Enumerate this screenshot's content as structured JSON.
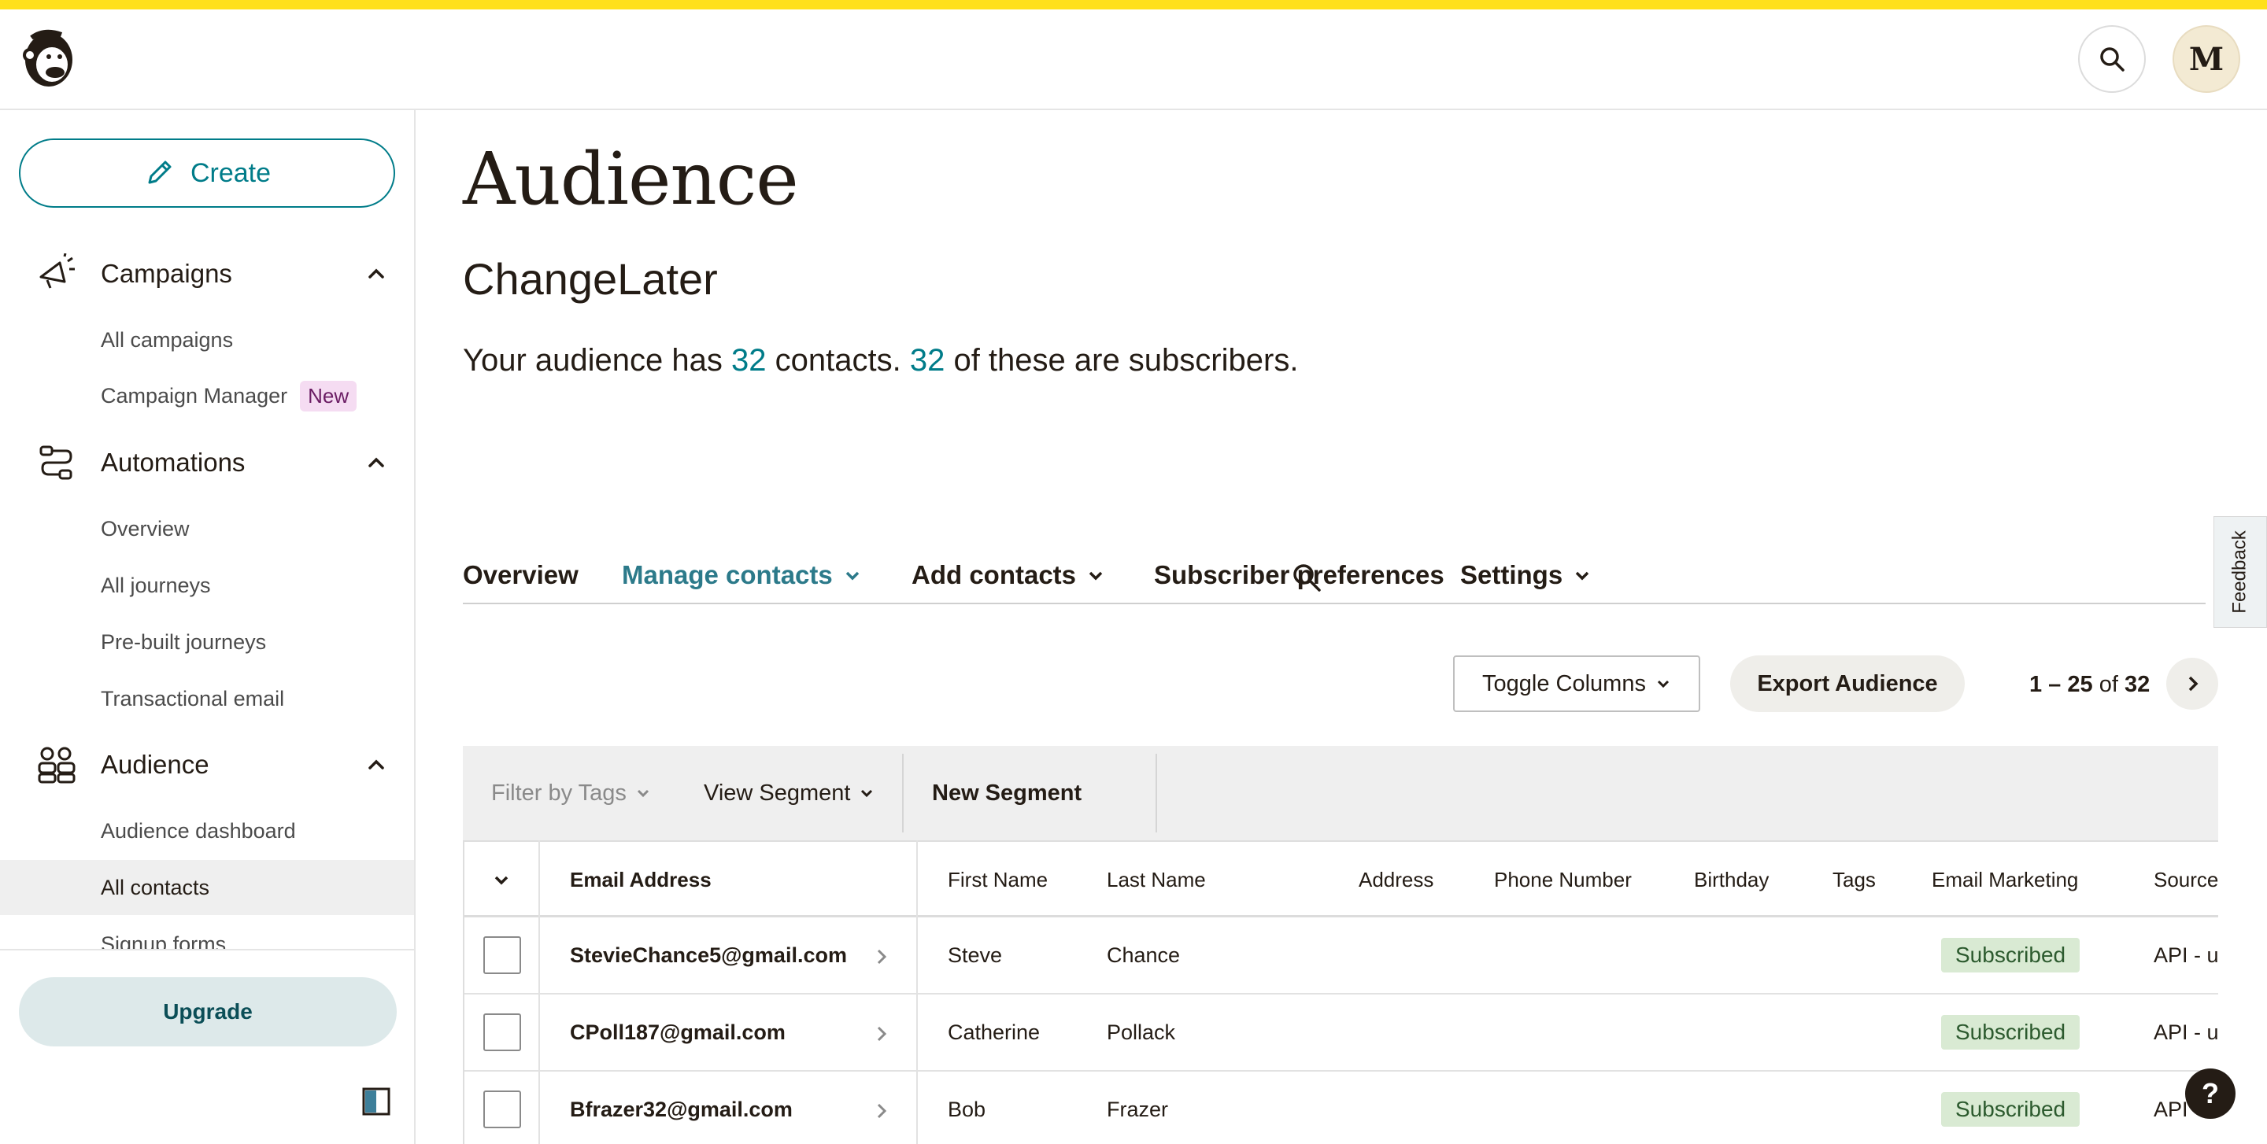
{
  "header": {
    "logo_icon": "mailchimp-freddie-icon",
    "search_icon": "search-icon",
    "avatar_letter": "M"
  },
  "sidebar": {
    "create_label": "Create",
    "sections": [
      {
        "label": "Campaigns",
        "icon": "megaphone-icon",
        "items": [
          {
            "label": "All campaigns"
          },
          {
            "label": "Campaign Manager",
            "badge": "New"
          }
        ]
      },
      {
        "label": "Automations",
        "icon": "workflow-icon",
        "items": [
          {
            "label": "Overview"
          },
          {
            "label": "All journeys"
          },
          {
            "label": "Pre-built journeys"
          },
          {
            "label": "Transactional email"
          }
        ]
      },
      {
        "label": "Audience",
        "icon": "people-icon",
        "items": [
          {
            "label": "Audience dashboard"
          },
          {
            "label": "All contacts",
            "active": true
          },
          {
            "label": "Signup forms"
          }
        ]
      }
    ],
    "upgrade_label": "Upgrade"
  },
  "main": {
    "title": "Audience",
    "audience_name": "ChangeLater",
    "summary": {
      "prefix": "Your audience has ",
      "contacts": "32",
      "middle": " contacts. ",
      "subscribers": "32",
      "suffix": " of these are subscribers."
    },
    "tabs": [
      {
        "label": "Overview"
      },
      {
        "label": "Manage contacts",
        "active": true,
        "dropdown": true
      },
      {
        "label": "Add contacts",
        "dropdown": true
      },
      {
        "label": "Subscriber preferences"
      },
      {
        "label": "Settings",
        "dropdown": true
      }
    ],
    "feedback_label": "Feedback",
    "toolbar": {
      "toggle_columns": "Toggle Columns",
      "export_audience": "Export Audience",
      "pager_range": "1 – 25",
      "pager_of": " of ",
      "pager_total": "32"
    },
    "filter_bar": {
      "filter_by_tags": "Filter by Tags",
      "view_segment": "View Segment",
      "new_segment": "New Segment"
    },
    "table": {
      "columns": [
        "Email Address",
        "First Name",
        "Last Name",
        "Address",
        "Phone Number",
        "Birthday",
        "Tags",
        "Email Marketing",
        "Source"
      ],
      "rows": [
        {
          "email": "StevieChance5@gmail.com",
          "first": "Steve",
          "last": "Chance",
          "marketing": "Subscribed",
          "source": "API - ur"
        },
        {
          "email": "CPoll187@gmail.com",
          "first": "Catherine",
          "last": "Pollack",
          "marketing": "Subscribed",
          "source": "API - ur"
        },
        {
          "email": "Bfrazer32@gmail.com",
          "first": "Bob",
          "last": "Frazer",
          "marketing": "Subscribed",
          "source": "API - ur"
        }
      ]
    },
    "help_label": "?"
  },
  "colors": {
    "accent": "#007c89",
    "brand_yellow": "#ffe01b",
    "subscribed_bg": "#d9ead3"
  }
}
